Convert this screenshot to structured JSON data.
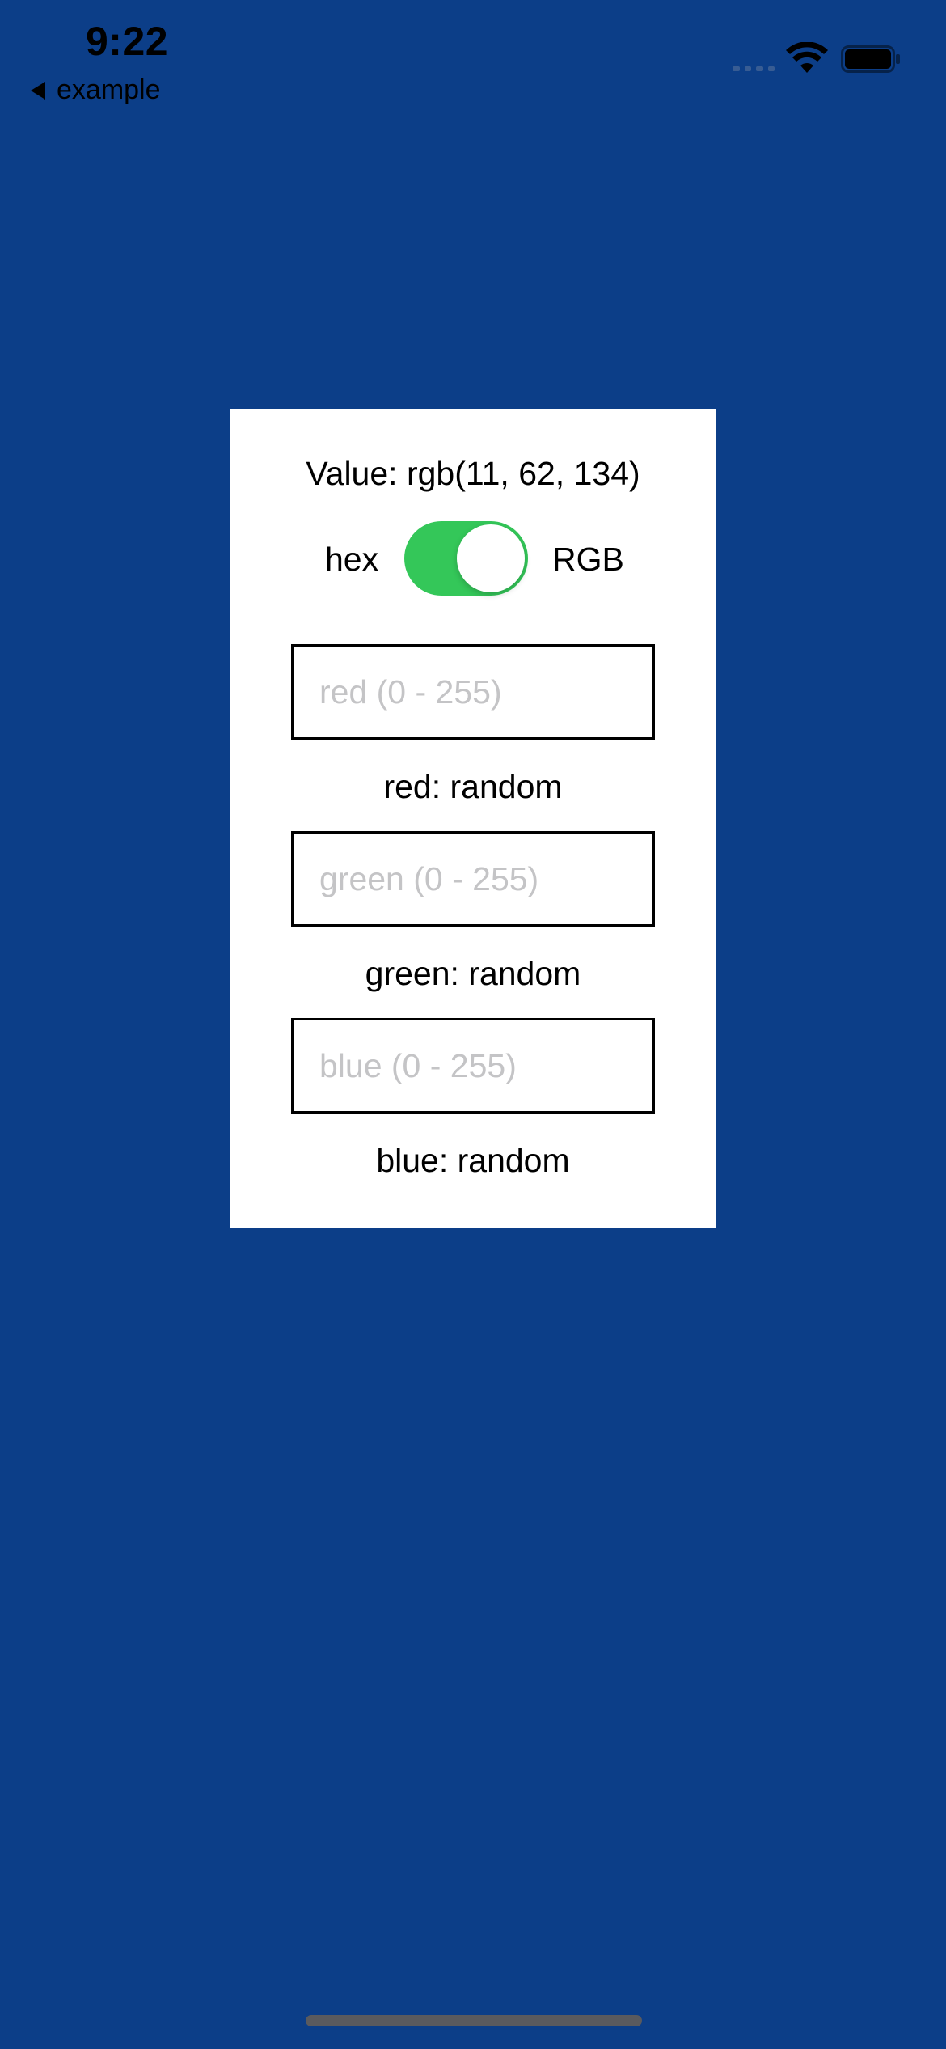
{
  "status_bar": {
    "time": "9:22",
    "back_label": "example"
  },
  "card": {
    "value_text": "Value: rgb(11, 62, 134)",
    "toggle": {
      "left_label": "hex",
      "right_label": "RGB",
      "on": true
    },
    "fields": [
      {
        "placeholder": "red (0 - 255)",
        "value": "",
        "caption": "red: random"
      },
      {
        "placeholder": "green (0 - 255)",
        "value": "",
        "caption": "green: random"
      },
      {
        "placeholder": "blue (0 - 255)",
        "value": "",
        "caption": "blue: random"
      }
    ]
  },
  "colors": {
    "background": "#0c3e88",
    "toggle_on": "#34c759",
    "card": "#ffffff"
  }
}
